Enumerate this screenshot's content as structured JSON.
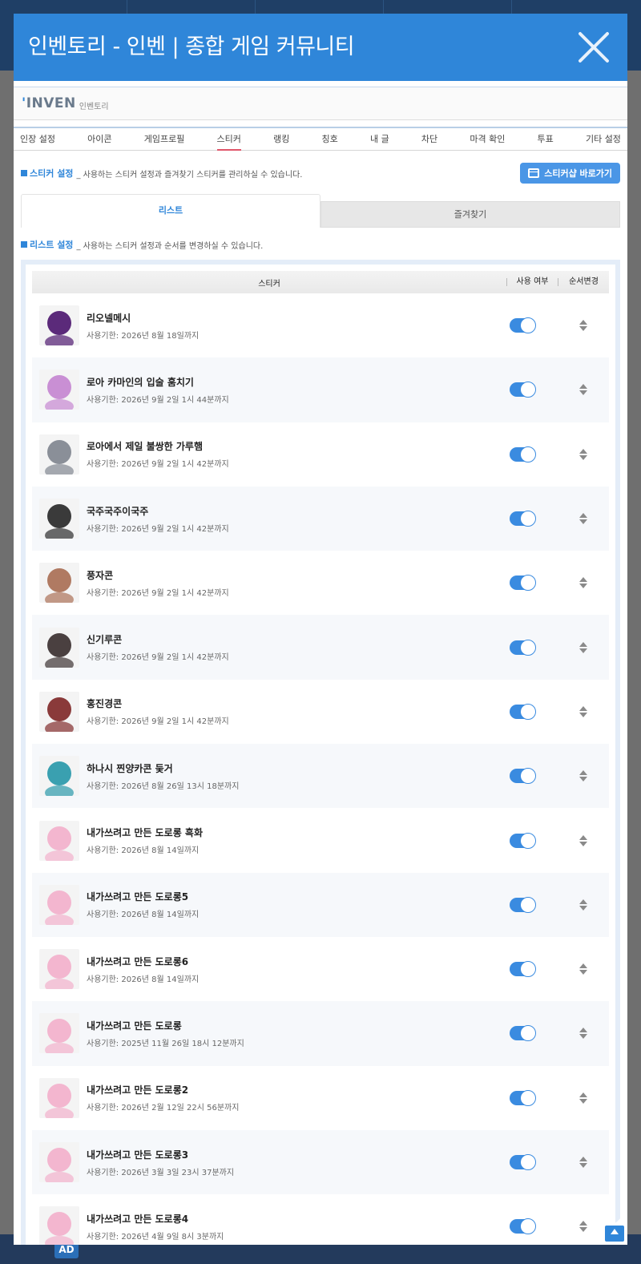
{
  "modal": {
    "title": "인벤토리 - 인벤 | 종합 게임 커뮤니티",
    "brand_logo": "INVEN",
    "brand_sub": "인벤토리"
  },
  "nav": [
    "인장 설정",
    "아이콘",
    "게임프로필",
    "스티커",
    "랭킹",
    "칭호",
    "내 글",
    "차단",
    "마격 확인",
    "투표",
    "기타 설정"
  ],
  "sticker_section": {
    "label": "스티커 설정",
    "desc": "_ 사용하는 스티커 설정과 즐겨찾기 스티커를 관리하실 수 있습니다.",
    "shop_button": "스티커샵 바로가기"
  },
  "tabs": {
    "list": "리스트",
    "favorites": "즐겨찾기"
  },
  "list_section": {
    "label": "리스트 설정",
    "desc": "_ 사용하는 스티커 설정과 순서를 변경하실 수 있습니다."
  },
  "list_header": {
    "sticker": "스티커",
    "use": "사용 여부",
    "order": "순서변경"
  },
  "stickers": [
    {
      "name": "리오넬메시",
      "expiry": "사용기한: 2026년 8월 18일까지",
      "thumb": "#5b2a7a",
      "enabled": true
    },
    {
      "name": "로아 카마인의 입술 훔치기",
      "expiry": "사용기한: 2026년 9월 2일 1시 44분까지",
      "thumb": "#c98fd4",
      "enabled": true
    },
    {
      "name": "로아에서 제일 불쌍한 가루햄",
      "expiry": "사용기한: 2026년 9월 2일 1시 42분까지",
      "thumb": "#8a8f98",
      "enabled": true
    },
    {
      "name": "국주국주이국주",
      "expiry": "사용기한: 2026년 9월 2일 1시 42분까지",
      "thumb": "#3a3a3a",
      "enabled": true
    },
    {
      "name": "풍자콘",
      "expiry": "사용기한: 2026년 9월 2일 1시 42분까지",
      "thumb": "#b07a62",
      "enabled": true
    },
    {
      "name": "신기루콘",
      "expiry": "사용기한: 2026년 9월 2일 1시 42분까지",
      "thumb": "#4a4040",
      "enabled": true
    },
    {
      "name": "홍진경콘",
      "expiry": "사용기한: 2026년 9월 2일 1시 42분까지",
      "thumb": "#8a3a3a",
      "enabled": true
    },
    {
      "name": "하나시 찐양카콘 둦거",
      "expiry": "사용기한: 2026년 8월 26일 13시 18분까지",
      "thumb": "#3aa0b0",
      "enabled": true
    },
    {
      "name": "내가쓰려고 만든 도로롱 흑화",
      "expiry": "사용기한: 2026년 8월 14일까지",
      "thumb": "#f3b6cf",
      "enabled": true
    },
    {
      "name": "내가쓰려고 만든 도로롱5",
      "expiry": "사용기한: 2026년 8월 14일까지",
      "thumb": "#f3b6cf",
      "enabled": true
    },
    {
      "name": "내가쓰려고 만든 도로롱6",
      "expiry": "사용기한: 2026년 8월 14일까지",
      "thumb": "#f3b6cf",
      "enabled": true
    },
    {
      "name": "내가쓰려고 만든 도로롱",
      "expiry": "사용기한: 2025년 11월 26일 18시 12분까지",
      "thumb": "#f3b6cf",
      "enabled": true
    },
    {
      "name": "내가쓰려고 만든 도로롱2",
      "expiry": "사용기한: 2026년 2월 12일 22시 56분까지",
      "thumb": "#f3b6cf",
      "enabled": true
    },
    {
      "name": "내가쓰려고 만든 도로롱3",
      "expiry": "사용기한: 2026년 3월 3일 23시 37분까지",
      "thumb": "#f3b6cf",
      "enabled": true
    },
    {
      "name": "내가쓰려고 만든 도로롱4",
      "expiry": "사용기한: 2026년 4월 9일 8시 3분까지",
      "thumb": "#f3b6cf",
      "enabled": true
    }
  ],
  "backdrop": {
    "ad_badge": "AD"
  }
}
